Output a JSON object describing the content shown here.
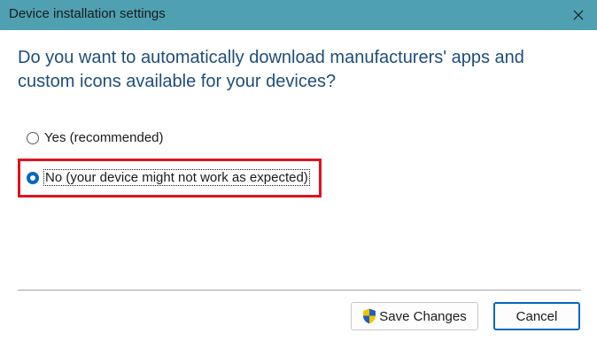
{
  "window": {
    "title": "Device installation settings",
    "close_icon": "close-icon"
  },
  "content": {
    "question": "Do you want to automatically download manufacturers' apps and custom icons available for your devices?",
    "options": [
      {
        "label": "Yes (recommended)",
        "selected": false
      },
      {
        "label": "No (your device might not work as expected)",
        "selected": true
      }
    ]
  },
  "footer": {
    "save_label": "Save Changes",
    "save_icon": "uac-shield-icon",
    "cancel_label": "Cancel"
  },
  "colors": {
    "titlebar": "#4fa0b1",
    "question_text": "#1f4e79",
    "accent": "#0067c0",
    "annotation_red": "#e0121b"
  }
}
